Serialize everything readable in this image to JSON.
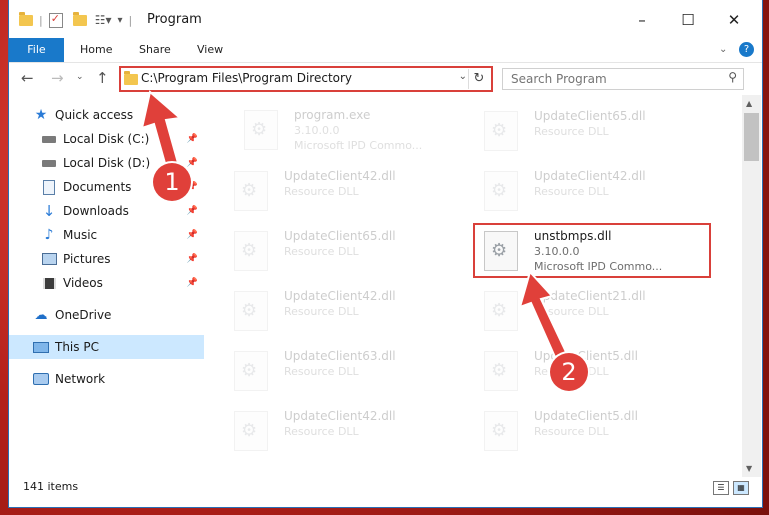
{
  "window": {
    "title": "Program",
    "controls": [
      "–",
      "☐",
      "✕"
    ]
  },
  "ribbon": {
    "file": "File",
    "tabs": [
      "Home",
      "Share",
      "View"
    ],
    "help": "?"
  },
  "address": {
    "path": "C:\\Program Files\\Program Directory",
    "search_placeholder": "Search Program"
  },
  "nav": {
    "items": [
      {
        "label": "Quick access",
        "icon": "star-icon"
      },
      {
        "label": "Local Disk (C:)",
        "icon": "drive-icon",
        "pinned": true
      },
      {
        "label": "Local Disk (D:)",
        "icon": "drive-icon",
        "pinned": true
      },
      {
        "label": "Documents",
        "icon": "documents-icon",
        "pinned": true
      },
      {
        "label": "Downloads",
        "icon": "download-icon",
        "pinned": true
      },
      {
        "label": "Music",
        "icon": "music-icon",
        "pinned": true
      },
      {
        "label": "Pictures",
        "icon": "pictures-icon",
        "pinned": true
      },
      {
        "label": "Videos",
        "icon": "videos-icon",
        "pinned": true
      },
      {
        "label": "OneDrive",
        "icon": "cloud-icon"
      },
      {
        "label": "This PC",
        "icon": "computer-icon",
        "selected": true
      },
      {
        "label": "Network",
        "icon": "network-icon"
      }
    ]
  },
  "files": {
    "left": [
      {
        "name": "program.exe",
        "line2": "3.10.0.0",
        "line3": "Microsoft IPD Commo..."
      },
      {
        "name": "UpdateClient42.dll",
        "line2": "Resource DLL",
        "line3": ""
      },
      {
        "name": "UpdateClient65.dll",
        "line2": "Resource DLL",
        "line3": ""
      },
      {
        "name": "UpdateClient42.dll",
        "line2": "Resource DLL",
        "line3": ""
      },
      {
        "name": "UpdateClient63.dll",
        "line2": "Resource DLL",
        "line3": ""
      },
      {
        "name": "UpdateClient42.dll",
        "line2": "Resource DLL",
        "line3": ""
      }
    ],
    "right": [
      {
        "name": "UpdateClient65.dll",
        "line2": "Resource DLL",
        "line3": ""
      },
      {
        "name": "UpdateClient42.dll",
        "line2": "Resource DLL",
        "line3": ""
      },
      {
        "name": "unstbmps.dll",
        "line2": "3.10.0.0",
        "line3": "Microsoft IPD Commo...",
        "highlighted": true
      },
      {
        "name": "UpdateClient21.dll",
        "line2": "Resource DLL",
        "line3": ""
      },
      {
        "name": "UpdateClient5.dll",
        "line2": "Resource DLL",
        "line3": ""
      },
      {
        "name": "UpdateClient5.dll",
        "line2": "Resource DLL",
        "line3": ""
      }
    ]
  },
  "status": {
    "count": "141 items"
  },
  "annotations": [
    {
      "label": "1"
    },
    {
      "label": "2"
    }
  ],
  "colors": {
    "accent": "#1979ca",
    "annotation": "#d9403a",
    "selected": "#cce8ff"
  }
}
